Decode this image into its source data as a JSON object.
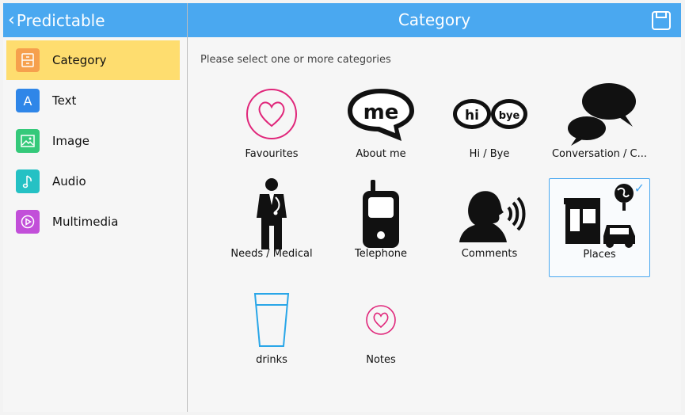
{
  "header": {
    "back_label": "Predictable",
    "title": "Category"
  },
  "sidebar": {
    "items": [
      {
        "label": "Category",
        "icon": "category-icon",
        "color": "#f6a04d",
        "active": true
      },
      {
        "label": "Text",
        "icon": "text-icon",
        "color": "#2f86e8",
        "active": false
      },
      {
        "label": "Image",
        "icon": "image-icon",
        "color": "#35c97a",
        "active": false
      },
      {
        "label": "Audio",
        "icon": "audio-icon",
        "color": "#25c1c4",
        "active": false
      },
      {
        "label": "Multimedia",
        "icon": "multimedia-icon",
        "color": "#c24fd9",
        "active": false
      }
    ]
  },
  "main": {
    "prompt": "Please select one or more categories",
    "tiles": [
      {
        "label": "Favourites",
        "icon": "heart-circle-icon",
        "selected": false
      },
      {
        "label": "About me",
        "icon": "me-speech-bubble-icon",
        "selected": false
      },
      {
        "label": "Hi / Bye",
        "icon": "hi-bye-bubbles-icon",
        "selected": false
      },
      {
        "label": "Conversation / C...",
        "icon": "conversation-bubbles-icon",
        "selected": false
      },
      {
        "label": "Needs / Medical",
        "icon": "doctor-icon",
        "selected": false
      },
      {
        "label": "Telephone",
        "icon": "mobile-phone-icon",
        "selected": false
      },
      {
        "label": "Comments",
        "icon": "speaking-head-icon",
        "selected": false
      },
      {
        "label": "Places",
        "icon": "places-icon",
        "selected": true
      },
      {
        "label": "drinks",
        "icon": "glass-of-water-icon",
        "selected": false
      },
      {
        "label": "Notes",
        "icon": "small-heart-circle-icon",
        "selected": false
      }
    ]
  },
  "colors": {
    "header": "#4aa8f0",
    "active_item": "#fedd6f",
    "heart": "#e0267a",
    "selection": "#4aa8f0"
  }
}
